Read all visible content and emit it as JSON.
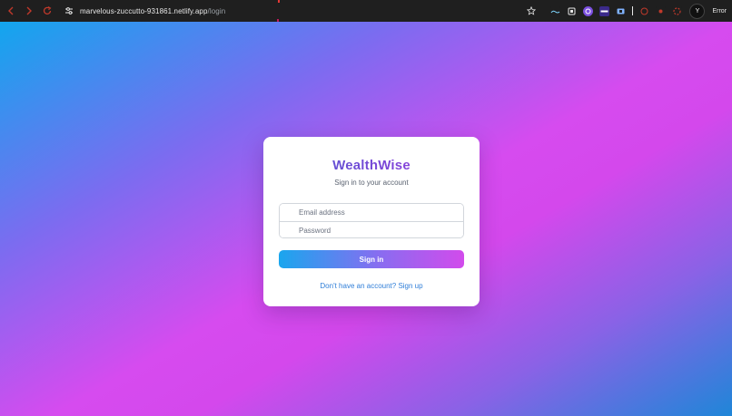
{
  "browser": {
    "url_host": "marvelous-zuccutto-931861.netlify.app",
    "url_path": "/login",
    "profile_initial": "Y",
    "error_label": "Error",
    "extensions": [
      "ai",
      "copy",
      "gpt",
      "chat",
      "bookmark"
    ]
  },
  "login": {
    "brand": "WealthWise",
    "subtitle": "Sign in to your account",
    "email_placeholder": "Email address",
    "password_placeholder": "Password",
    "signin_label": "Sign in",
    "signup_link": "Don't have an account? Sign up"
  },
  "colors": {
    "bg_start": "#12a6ee",
    "bg_mid": "#d64bef",
    "bg_end": "#1f86d8",
    "brand_gradient_start": "#4b5fcf",
    "brand_gradient_end": "#a43ee0",
    "link": "#2f7ed8"
  }
}
